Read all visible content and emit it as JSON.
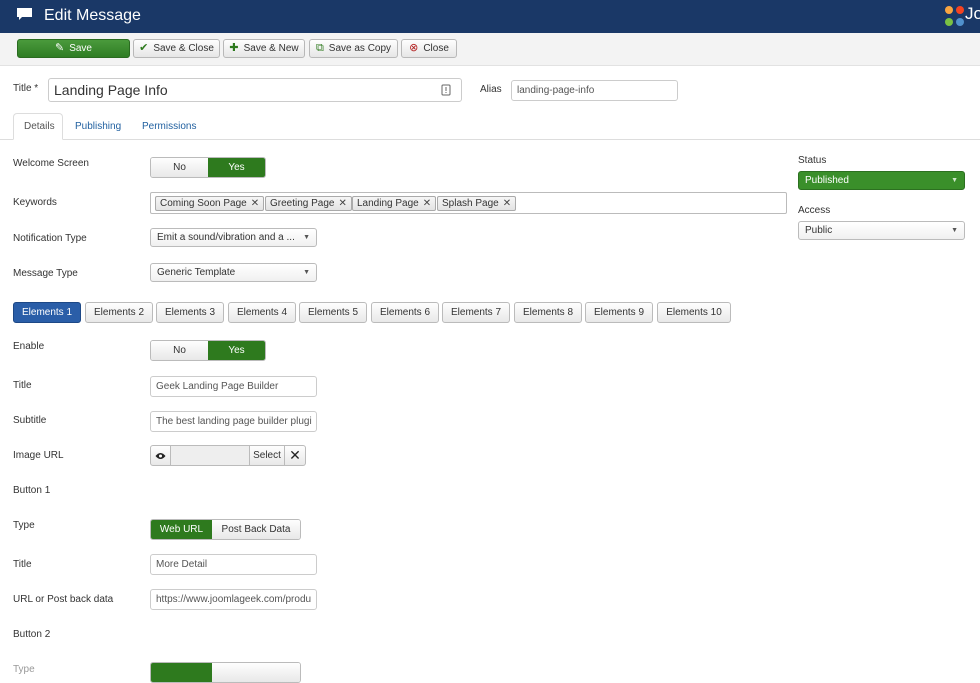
{
  "header": {
    "title": "Edit Message",
    "logo_text": "Jo"
  },
  "toolbar": {
    "save": "Save",
    "save_close": "Save & Close",
    "save_new": "Save & New",
    "save_copy": "Save as Copy",
    "close": "Close"
  },
  "title_field": {
    "label": "Title *",
    "value": "Landing Page Info"
  },
  "alias_field": {
    "label": "Alias",
    "value": "landing-page-info"
  },
  "tabs": [
    "Details",
    "Publishing",
    "Permissions"
  ],
  "form": {
    "welcome_label": "Welcome Screen",
    "no": "No",
    "yes": "Yes",
    "keywords_label": "Keywords",
    "keywords": [
      "Coming Soon Page",
      "Greeting Page",
      "Landing Page",
      "Splash Page"
    ],
    "notification_label": "Notification Type",
    "notification_value": "Emit a sound/vibration and a ...",
    "message_type_label": "Message Type",
    "message_type_value": "Generic Template"
  },
  "sidebar": {
    "status_label": "Status",
    "status_value": "Published",
    "access_label": "Access",
    "access_value": "Public"
  },
  "element_tabs": [
    "Elements 1",
    "Elements 2",
    "Elements 3",
    "Elements 4",
    "Elements 5",
    "Elements 6",
    "Elements 7",
    "Elements 8",
    "Elements 9",
    "Elements 10"
  ],
  "element": {
    "enable_label": "Enable",
    "title_label": "Title",
    "title_value": "Geek Landing Page Builder",
    "subtitle_label": "Subtitle",
    "subtitle_value": "The best landing page builder plugi",
    "image_label": "Image URL",
    "select_label": "Select",
    "button1_label": "Button 1",
    "type_label": "Type",
    "type_web": "Web URL",
    "type_post": "Post Back Data",
    "btn_title_label": "Title",
    "btn_title_value": "More Detail",
    "url_label": "URL or Post back data",
    "url_value": "https://www.joomlageek.com/produ",
    "button2_label": "Button 2",
    "type2_label": "Type"
  },
  "colors": {
    "header": "#1a3867",
    "green": "#2e7a1e",
    "blue_active": "#2a5ea8"
  }
}
